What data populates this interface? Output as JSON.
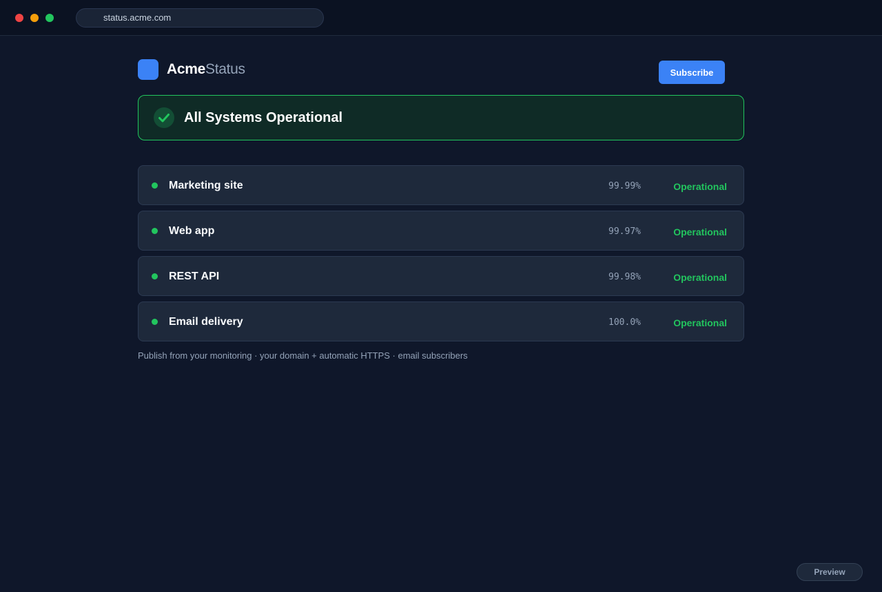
{
  "browser": {
    "url": "status.acme.com"
  },
  "brand": {
    "name_bold": "Acme",
    "name_light": "Status",
    "logo_color": "#3b82f6"
  },
  "header": {
    "subscribe_label": "Subscribe"
  },
  "banner": {
    "title": "All Systems Operational",
    "icon": "check-icon",
    "color": "#22c55e"
  },
  "services": [
    {
      "name": "Marketing site",
      "uptime": "99.99%",
      "status": "Operational"
    },
    {
      "name": "Web app",
      "uptime": "99.97%",
      "status": "Operational"
    },
    {
      "name": "REST API",
      "uptime": "99.98%",
      "status": "Operational"
    },
    {
      "name": "Email delivery",
      "uptime": "100.0%",
      "status": "Operational"
    }
  ],
  "footnote": "Publish from your monitoring · your domain + automatic HTTPS · email subscribers",
  "preview_label": "Preview",
  "colors": {
    "operational": "#22c55e",
    "accent": "#3b82f6",
    "background": "#0f172a"
  }
}
